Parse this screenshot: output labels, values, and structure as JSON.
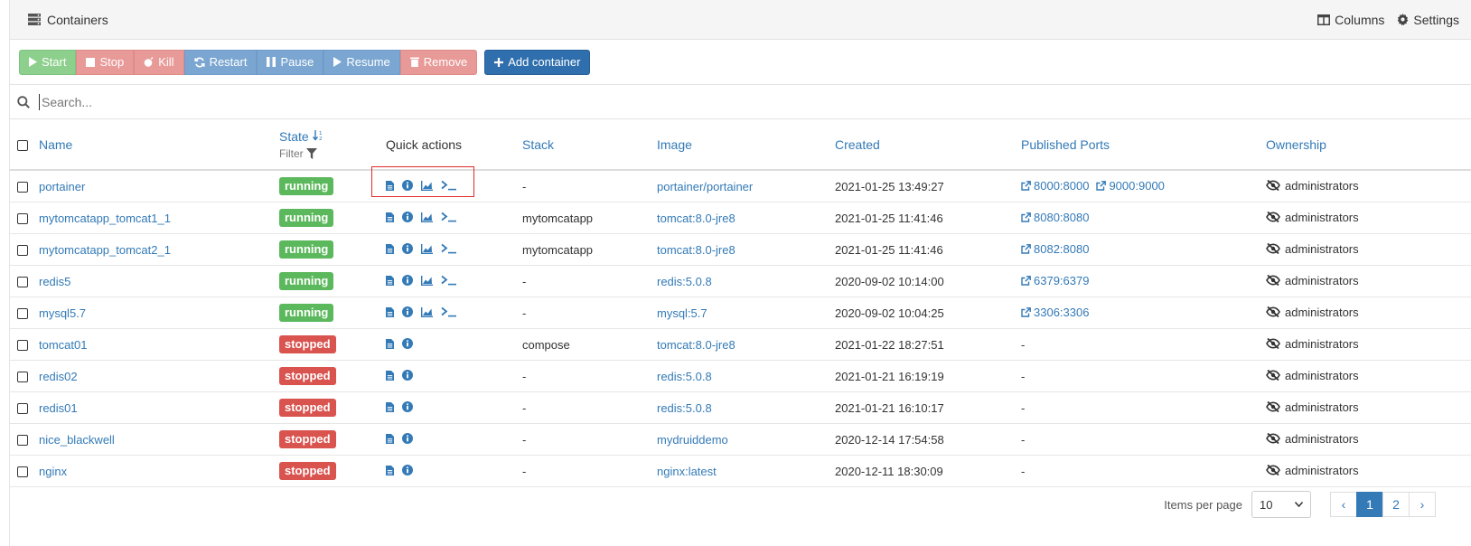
{
  "header": {
    "title": "Containers",
    "columns_label": "Columns",
    "settings_label": "Settings"
  },
  "toolbar": {
    "start": "Start",
    "stop": "Stop",
    "kill": "Kill",
    "restart": "Restart",
    "pause": "Pause",
    "resume": "Resume",
    "remove": "Remove",
    "add_container": "Add container"
  },
  "search": {
    "placeholder": "Search..."
  },
  "table": {
    "headers": {
      "name": "Name",
      "state": "State",
      "filter": "Filter",
      "quick_actions": "Quick actions",
      "stack": "Stack",
      "image": "Image",
      "created": "Created",
      "ports": "Published Ports",
      "ownership": "Ownership"
    },
    "rows": [
      {
        "name": "portainer",
        "state": "running",
        "stack": "-",
        "image": "portainer/portainer",
        "created": "2021-01-25 13:49:27",
        "ports": [
          "8000:8000",
          "9000:9000"
        ],
        "ownership": "administrators"
      },
      {
        "name": "mytomcatapp_tomcat1_1",
        "state": "running",
        "stack": "mytomcatapp",
        "image": "tomcat:8.0-jre8",
        "created": "2021-01-25 11:41:46",
        "ports": [
          "8080:8080"
        ],
        "ownership": "administrators"
      },
      {
        "name": "mytomcatapp_tomcat2_1",
        "state": "running",
        "stack": "mytomcatapp",
        "image": "tomcat:8.0-jre8",
        "created": "2021-01-25 11:41:46",
        "ports": [
          "8082:8080"
        ],
        "ownership": "administrators"
      },
      {
        "name": "redis5",
        "state": "running",
        "stack": "-",
        "image": "redis:5.0.8",
        "created": "2020-09-02 10:14:00",
        "ports": [
          "6379:6379"
        ],
        "ownership": "administrators"
      },
      {
        "name": "mysql5.7",
        "state": "running",
        "stack": "-",
        "image": "mysql:5.7",
        "created": "2020-09-02 10:04:25",
        "ports": [
          "3306:3306"
        ],
        "ownership": "administrators"
      },
      {
        "name": "tomcat01",
        "state": "stopped",
        "stack": "compose",
        "image": "tomcat:8.0-jre8",
        "created": "2021-01-22 18:27:51",
        "ports": [],
        "ownership": "administrators"
      },
      {
        "name": "redis02",
        "state": "stopped",
        "stack": "-",
        "image": "redis:5.0.8",
        "created": "2021-01-21 16:19:19",
        "ports": [],
        "ownership": "administrators"
      },
      {
        "name": "redis01",
        "state": "stopped",
        "stack": "-",
        "image": "redis:5.0.8",
        "created": "2021-01-21 16:10:17",
        "ports": [],
        "ownership": "administrators"
      },
      {
        "name": "nice_blackwell",
        "state": "stopped",
        "stack": "-",
        "image": "mydruiddemo",
        "created": "2020-12-14 17:54:58",
        "ports": [],
        "ownership": "administrators"
      },
      {
        "name": "nginx",
        "state": "stopped",
        "stack": "-",
        "image": "nginx:latest",
        "created": "2020-12-11 18:30:09",
        "ports": [],
        "ownership": "administrators"
      }
    ],
    "no_ports": "-"
  },
  "footer": {
    "items_per_page_label": "Items per page",
    "items_per_page_value": "10",
    "pages": [
      "1",
      "2"
    ],
    "current_page": "1",
    "prev": "‹",
    "next": "›"
  },
  "colors": {
    "running": "#5cb85c",
    "stopped": "#d9534f",
    "link": "#337ab7",
    "highlight": "#e02a2a"
  }
}
